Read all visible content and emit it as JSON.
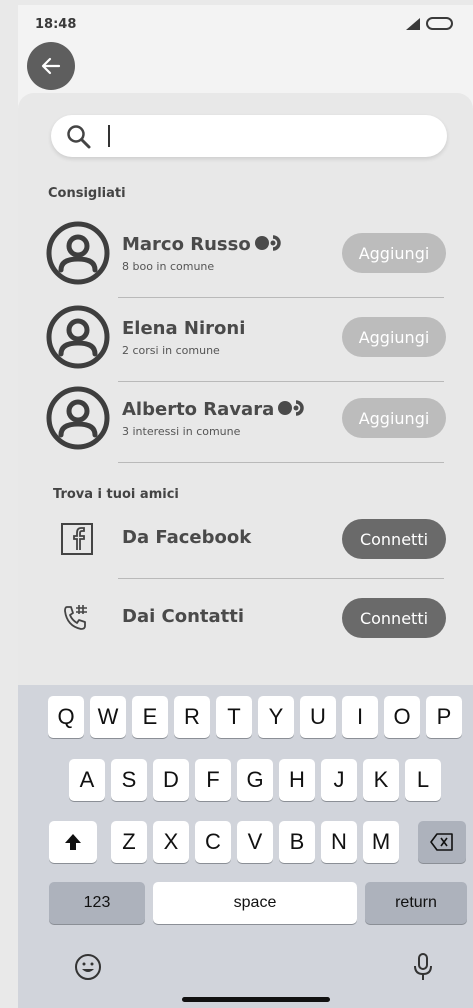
{
  "status_bar": {
    "time": "18:48"
  },
  "search": {
    "value": "",
    "placeholder": ""
  },
  "sections": {
    "suggested": "Consigliati",
    "find_friends": "Trova i tuoi amici"
  },
  "suggestions": [
    {
      "name": "Marco Russo",
      "subtitle": "8 boo in comune",
      "has_badge": true,
      "button": "Aggiungi"
    },
    {
      "name": "Elena Nironi",
      "subtitle": "2 corsi in comune",
      "has_badge": false,
      "button": "Aggiungi"
    },
    {
      "name": "Alberto Ravara",
      "subtitle": "3 interessi in comune",
      "has_badge": true,
      "button": "Aggiungi"
    }
  ],
  "friend_sources": [
    {
      "icon": "facebook-icon",
      "label": "Da Facebook",
      "button": "Connetti"
    },
    {
      "icon": "phone-contacts-icon",
      "label": "Dai Contatti",
      "button": "Connetti"
    }
  ],
  "keyboard": {
    "row1": [
      "Q",
      "W",
      "E",
      "R",
      "T",
      "Y",
      "U",
      "I",
      "O",
      "P"
    ],
    "row2": [
      "A",
      "S",
      "D",
      "F",
      "G",
      "H",
      "J",
      "K",
      "L"
    ],
    "row3": [
      "Z",
      "X",
      "C",
      "V",
      "B",
      "N",
      "M"
    ],
    "numbers": "123",
    "space": "space",
    "return": "return"
  },
  "colors": {
    "add_button": "#bcbcbc",
    "connect_button": "#6a6a6a",
    "back_button": "#5e5e5e",
    "keyboard_bg": "#d1d4db"
  }
}
